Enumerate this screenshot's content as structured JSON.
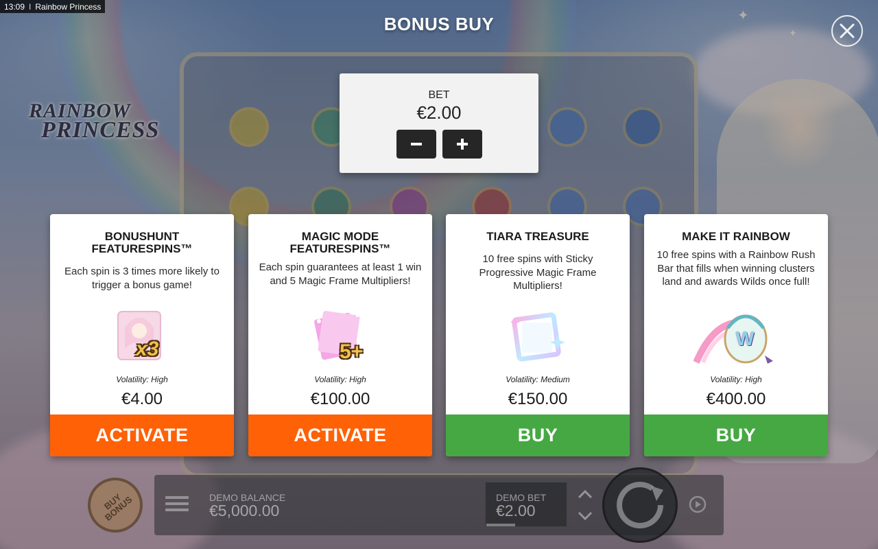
{
  "statusbar": {
    "time": "13:09",
    "separator": "I",
    "app_title": "Rainbow Princess"
  },
  "background": {
    "logo_line1": "RAINBOW",
    "logo_line2": "PRINCESS"
  },
  "modal": {
    "title": "BONUS BUY",
    "close_icon": "close-icon"
  },
  "bet": {
    "label": "BET",
    "value": "€2.00",
    "minus_icon": "minus-icon",
    "plus_icon": "plus-icon"
  },
  "cards": [
    {
      "title": "BONUSHUNT\nFEATURESPINS™",
      "description": "Each spin is 3 times more likely to trigger a bonus game!",
      "art_badge": "x3",
      "volatility": "Volatility: High",
      "price": "€4.00",
      "button": "ACTIVATE",
      "button_color": "#ff6107"
    },
    {
      "title": "MAGIC MODE\nFEATURESPINS™",
      "description": "Each spin guarantees at least 1 win and 5 Magic Frame Multipliers!",
      "art_badge": "5+",
      "volatility": "Volatility: High",
      "price": "€100.00",
      "button": "ACTIVATE",
      "button_color": "#ff6107"
    },
    {
      "title": "TIARA TREASURE",
      "description": "10 free spins with Sticky Progressive Magic Frame Multipliers!",
      "art_badge": "",
      "volatility": "Volatility: Medium",
      "price": "€150.00",
      "button": "BUY",
      "button_color": "#46a843"
    },
    {
      "title": "MAKE IT RAINBOW",
      "description": "10 free spins with a Rainbow Rush Bar that fills when winning clusters land and awards Wilds once full!",
      "art_badge": "W",
      "volatility": "Volatility: High",
      "price": "€400.00",
      "button": "BUY",
      "button_color": "#46a843"
    }
  ],
  "bottom_bar": {
    "buy_bonus": "BUY\nBONUS",
    "balance_label": "DEMO BALANCE",
    "balance_value": "€5,000.00",
    "bet_label": "DEMO BET",
    "bet_value": "€2.00",
    "menu_icon": "hamburger-menu-icon",
    "spin_icon": "spin-arrow-icon",
    "autoplay_icon": "autoplay-icon"
  }
}
